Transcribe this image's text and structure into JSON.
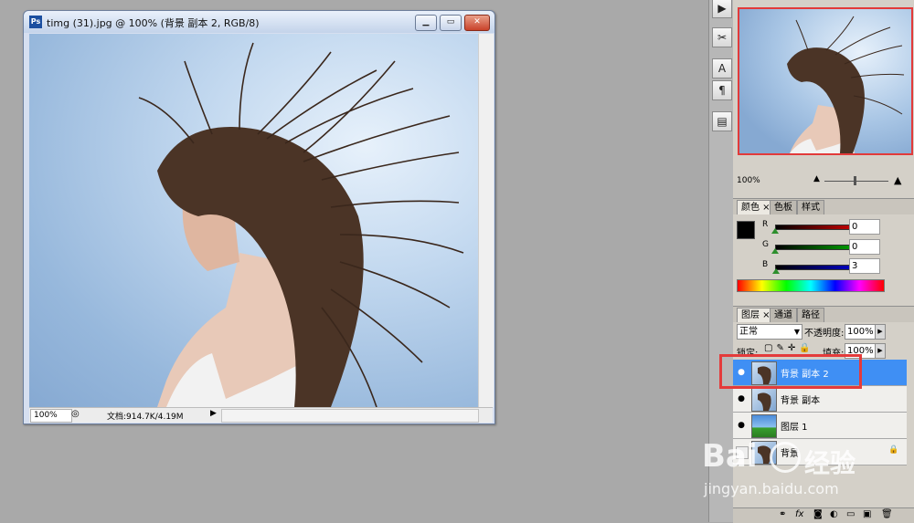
{
  "document": {
    "title": "timg (31).jpg @ 100% (背景 副本 2, RGB/8)",
    "status_zoom": "100%",
    "status_doc": "文档:914.7K/4.19M"
  },
  "navigator": {
    "zoom": "100%"
  },
  "color_panel": {
    "tabs": [
      "颜色",
      "色板",
      "样式"
    ],
    "channels": [
      {
        "label": "R",
        "value": "0",
        "color": "#cc0000"
      },
      {
        "label": "G",
        "value": "0",
        "color": "#00a000"
      },
      {
        "label": "B",
        "value": "3",
        "color": "#0000cc"
      }
    ]
  },
  "layers_panel": {
    "tabs": [
      "图层",
      "通道",
      "路径"
    ],
    "blend_mode": "正常",
    "opacity_label": "不透明度:",
    "opacity_value": "100%",
    "lock_label": "锁定:",
    "fill_label": "填充:",
    "fill_value": "100%",
    "layers": [
      {
        "name": "背景 副本 2",
        "selected": true
      },
      {
        "name": "背景 副本",
        "selected": false
      },
      {
        "name": "图层 1",
        "selected": false
      },
      {
        "name": "背景",
        "selected": false
      }
    ],
    "bottom_icons": [
      "link-icon",
      "fx-icon",
      "mask-icon",
      "adjustment-icon",
      "folder-icon",
      "new-layer-icon",
      "trash-icon"
    ]
  },
  "watermark": {
    "brand": "Bai",
    "brand2": "经验",
    "url": "jingyan.baidu.com"
  }
}
